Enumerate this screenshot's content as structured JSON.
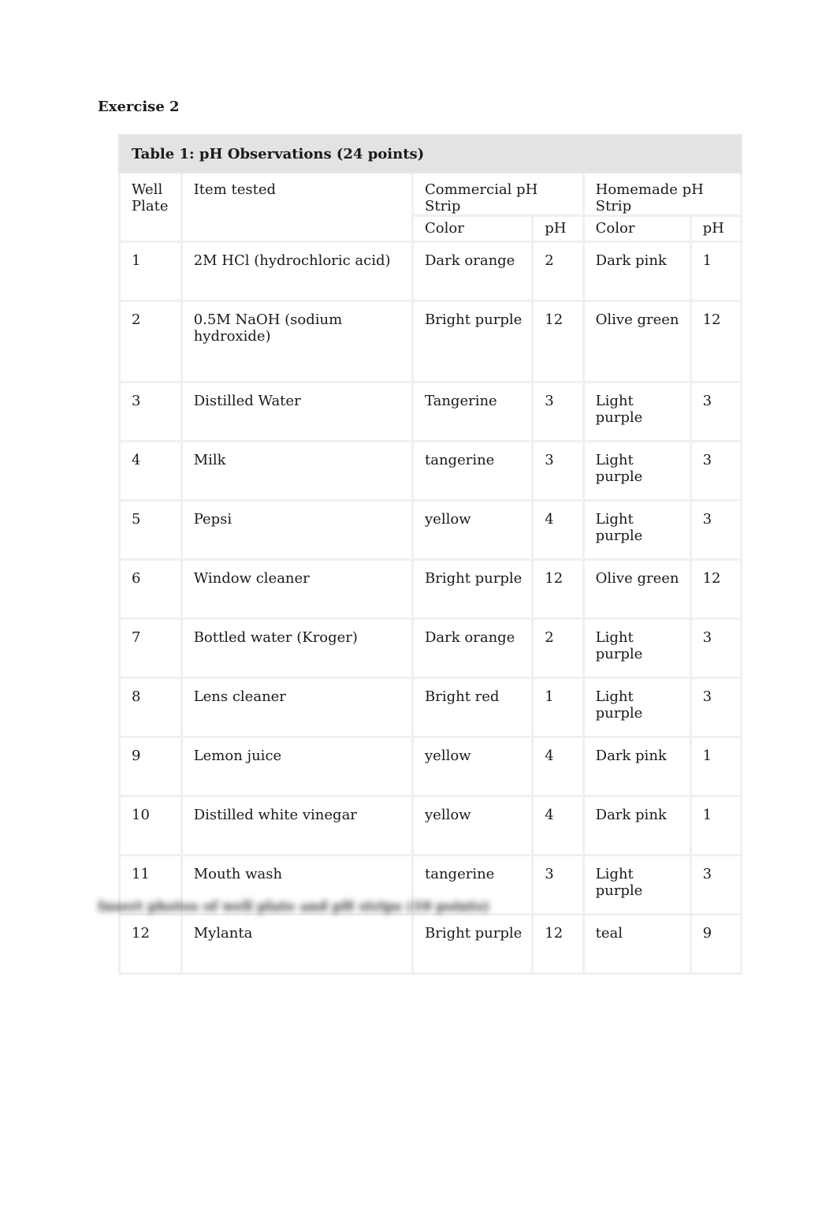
{
  "document": {
    "heading": "Exercise 2",
    "table": {
      "caption": "Table 1: pH Observations (24 points)",
      "headers": {
        "well": "Well Plate",
        "item": "Item tested",
        "commercial": "Commercial pH Strip",
        "homemade": "Homemade pH Strip",
        "color": "Color",
        "ph": "pH"
      },
      "rows": [
        {
          "well": "1",
          "item": "2M HCl (hydrochloric acid)",
          "c_color": "Dark orange",
          "c_ph": "2",
          "h_color": "Dark pink",
          "h_ph": "1"
        },
        {
          "well": "2",
          "item": "0.5M NaOH (sodium hydroxide)",
          "c_color": "Bright purple",
          "c_ph": "12",
          "h_color": "Olive green",
          "h_ph": "12"
        },
        {
          "well": "3",
          "item": "Distilled Water",
          "c_color": "Tangerine",
          "c_ph": "3",
          "h_color": "Light purple",
          "h_ph": "3"
        },
        {
          "well": "4",
          "item": "Milk",
          "c_color": "tangerine",
          "c_ph": "3",
          "h_color": "Light purple",
          "h_ph": "3"
        },
        {
          "well": "5",
          "item": "Pepsi",
          "c_color": "yellow",
          "c_ph": "4",
          "h_color": "Light purple",
          "h_ph": "3"
        },
        {
          "well": "6",
          "item": "Window cleaner",
          "c_color": "Bright purple",
          "c_ph": "12",
          "h_color": "Olive green",
          "h_ph": "12"
        },
        {
          "well": "7",
          "item": "Bottled water (Kroger)",
          "c_color": "Dark orange",
          "c_ph": "2",
          "h_color": "Light purple",
          "h_ph": "3"
        },
        {
          "well": "8",
          "item": "Lens cleaner",
          "c_color": "Bright red",
          "c_ph": "1",
          "h_color": "Light purple",
          "h_ph": "3"
        },
        {
          "well": "9",
          "item": "Lemon juice",
          "c_color": "yellow",
          "c_ph": "4",
          "h_color": "Dark pink",
          "h_ph": "1"
        },
        {
          "well": "10",
          "item": "Distilled white vinegar",
          "c_color": "yellow",
          "c_ph": "4",
          "h_color": "Dark pink",
          "h_ph": "1"
        },
        {
          "well": "11",
          "item": "Mouth wash",
          "c_color": "tangerine",
          "c_ph": "3",
          "h_color": "Light purple",
          "h_ph": "3"
        },
        {
          "well": "12",
          "item": "Mylanta",
          "c_color": "Bright purple",
          "c_ph": "12",
          "h_color": "teal",
          "h_ph": "9"
        }
      ]
    },
    "blurred_note": "Insert photos of well plate and pH strips (10 points)"
  }
}
